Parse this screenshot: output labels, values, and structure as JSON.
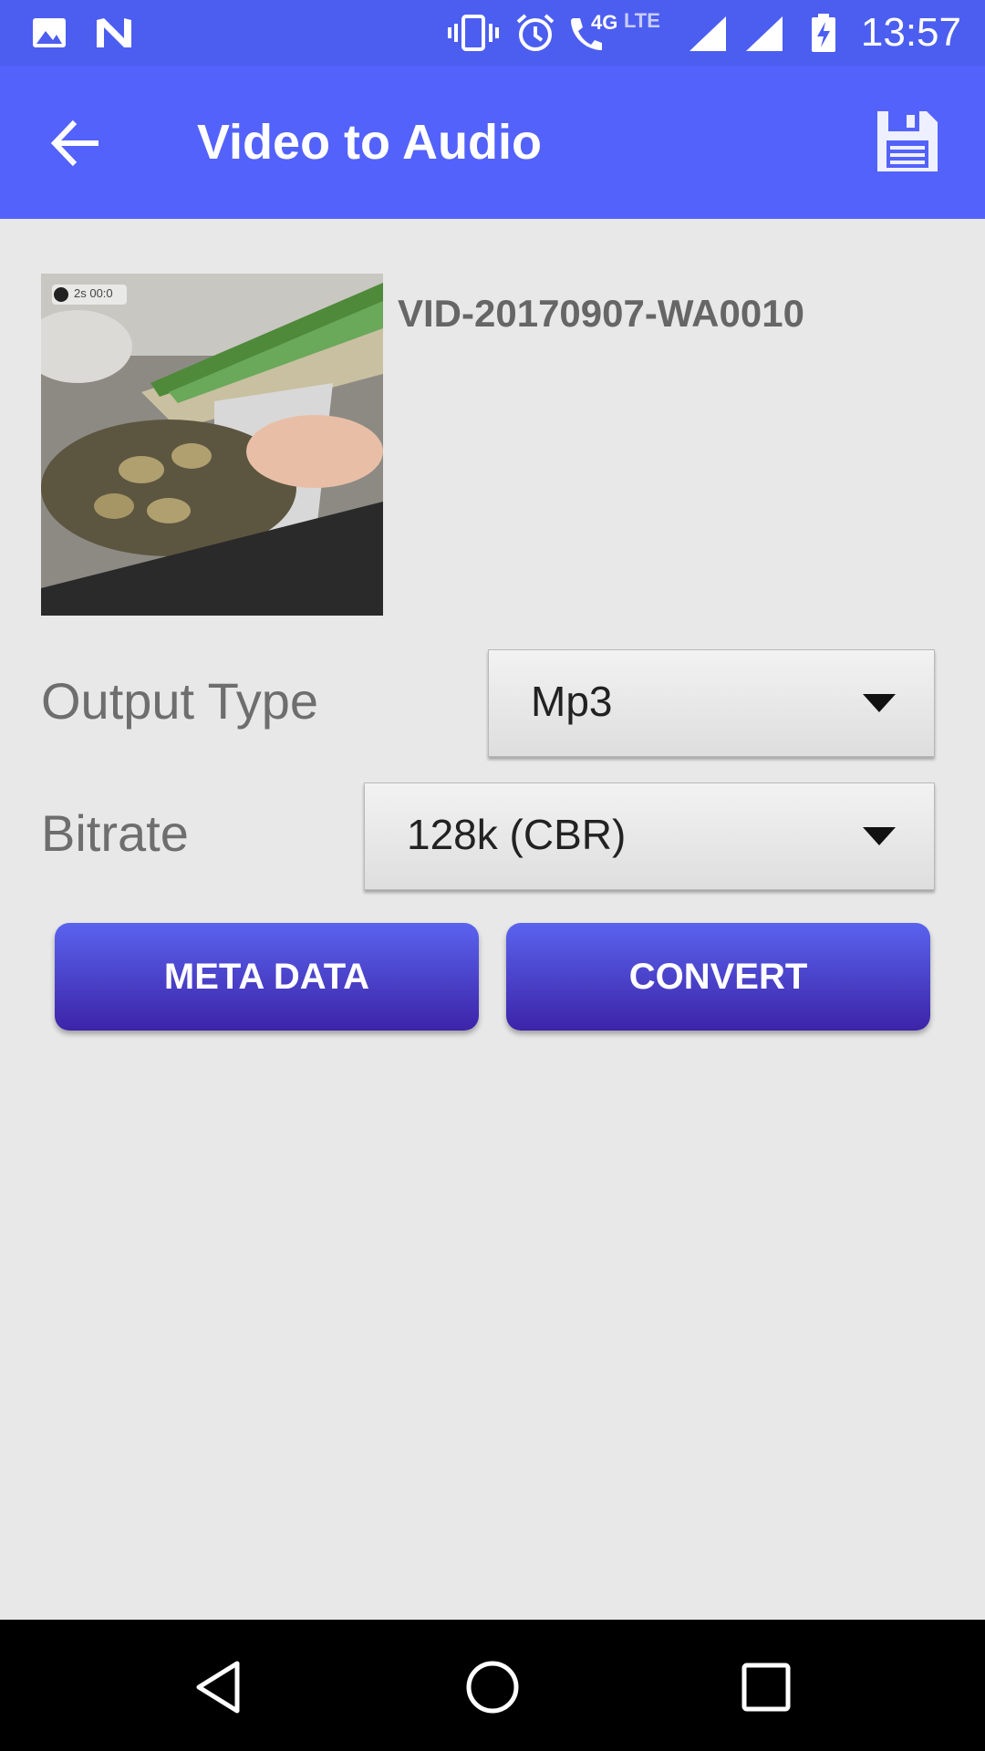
{
  "status_bar": {
    "time": "13:57",
    "network_label": "4G",
    "lte_label": "LTE",
    "icons": [
      "image-icon",
      "n-icon",
      "vibrate-icon",
      "alarm-icon",
      "call-icon",
      "signal-icon",
      "signal-icon",
      "battery-charging-icon"
    ]
  },
  "app_bar": {
    "title": "Video to Audio",
    "back_icon": "arrow-back-icon",
    "save_icon": "floppy-disk-icon",
    "background": "#5362fb"
  },
  "video": {
    "file_name": "VID-20170907-WA0010",
    "thumbnail_badge": "2s 00:0"
  },
  "output_type": {
    "label": "Output Type",
    "selected": "Mp3"
  },
  "bitrate": {
    "label": "Bitrate",
    "selected": "128k (CBR)"
  },
  "buttons": {
    "meta_data": "META DATA",
    "convert": "CONVERT"
  },
  "nav_bar": {
    "icons": [
      "back-triangle-icon",
      "home-circle-icon",
      "recents-square-icon"
    ]
  }
}
